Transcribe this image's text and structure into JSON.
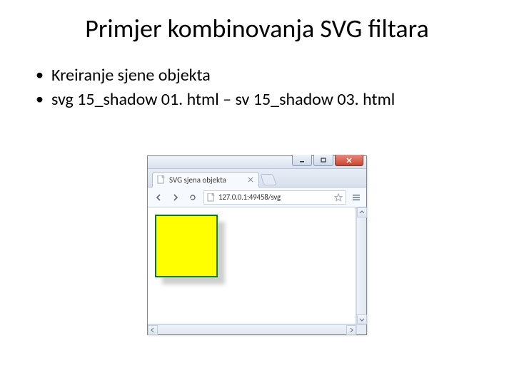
{
  "slide": {
    "title": "Primjer kombinovanja SVG filtara",
    "bullets": [
      "Kreiranje sjene objekta",
      "svg 15_shadow 01. html – sv 15_shadow 03. html"
    ]
  },
  "browser": {
    "tab_title": "SVG sjena objekta",
    "address": "127.0.0.1:49458/svg",
    "svg_square": {
      "fill": "#ffff00",
      "stroke": "#0b7a12"
    }
  }
}
